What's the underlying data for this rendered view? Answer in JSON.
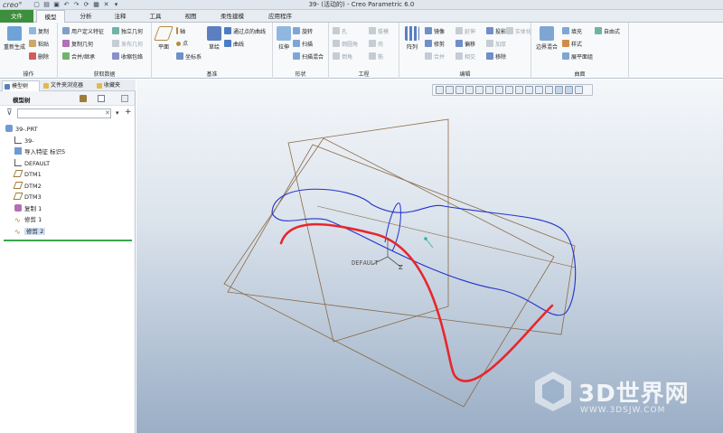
{
  "window": {
    "logo": "creo°",
    "title": "39- (活动的) - Creo Parametric 6.0"
  },
  "quick_access": [
    "new-icon",
    "open-icon",
    "save-icon",
    "undo-icon",
    "redo-icon",
    "regenerate-icon",
    "windows-icon",
    "close-icon",
    "customize-icon"
  ],
  "tabs": [
    "文件",
    "模型",
    "分析",
    "注释",
    "工具",
    "视图",
    "柔性建模",
    "应用程序"
  ],
  "ribbon": {
    "operations": {
      "label": "操作",
      "regen": "重新生成",
      "copy": "复制",
      "paste": "粘贴",
      "delete": "删除"
    },
    "get_data": {
      "label": "获取数据",
      "udf": "用户定义特征",
      "copy_geom": "复制几何",
      "merge": "合并/继承",
      "shrink": "收缩包络",
      "independent": "独立几何",
      "publish": "发布几何"
    },
    "datum": {
      "label": "基准",
      "plane": "平面",
      "axis": "轴",
      "point": "点",
      "csys": "坐标系",
      "sketch": "草绘",
      "curve_thru": "通过点的曲线",
      "curve": "曲线"
    },
    "shapes": {
      "label": "形状",
      "extrude": "拉伸",
      "revolve": "旋转",
      "sweep": "扫描",
      "swept_blend": "扫描混合"
    },
    "engineering": {
      "label": "工程",
      "hole": "孔",
      "round": "倒圆角",
      "chamfer": "倒角",
      "draft": "拔模",
      "shell": "壳",
      "rib": "筋"
    },
    "editing": {
      "label": "编辑",
      "pattern": "阵列",
      "mirror": "镜像",
      "trim": "修剪",
      "merge": "合并",
      "extend": "延伸",
      "offset": "偏移",
      "intersect": "相交",
      "project": "投影",
      "thicken": "加厚",
      "solidify": "实体化",
      "remove": "移除"
    },
    "surfaces": {
      "label": "曲面",
      "boundary": "边界混合",
      "fill": "填充",
      "style": "样式",
      "freeform": "自由式",
      "flatten": "展平面组"
    }
  },
  "nav_tabs": [
    "模型树",
    "文件夹浏览器",
    "收藏夹"
  ],
  "model_tree": {
    "title": "模型树",
    "filter_placeholder": "",
    "items": [
      {
        "label": "39-.PRT",
        "icon": "part-icon",
        "selected": false
      },
      {
        "label": "39-",
        "icon": "csys-icon",
        "selected": false
      },
      {
        "label": "导入特征 标识5",
        "icon": "import-feature-icon",
        "selected": false
      },
      {
        "label": "DEFAULT",
        "icon": "csys-icon",
        "selected": false
      },
      {
        "label": "DTM1",
        "icon": "datum-plane-icon",
        "selected": false
      },
      {
        "label": "DTM2",
        "icon": "datum-plane-icon",
        "selected": false
      },
      {
        "label": "DTM3",
        "icon": "datum-plane-icon",
        "selected": false
      },
      {
        "label": "复制 1",
        "icon": "copy-surface-icon",
        "selected": false
      },
      {
        "label": "修剪 1",
        "icon": "trim-curve-icon",
        "selected": false
      },
      {
        "label": "修剪 2",
        "icon": "trim-curve-icon",
        "selected": true
      }
    ]
  },
  "viewport": {
    "csys_label": "DEFAULT",
    "axis_label": "Z",
    "colors": {
      "curve_blue": "#2233cc",
      "curve_red": "#e8262b",
      "plane_edge": "#8a6a45"
    },
    "watermark": {
      "title": "3D世界网",
      "url": "WWW.3DSJW.COM"
    }
  },
  "colors": {
    "file_tab": "#3d8f3d",
    "ribbon_bg": "#f7f9fb",
    "selection": "#cfe0f5"
  }
}
